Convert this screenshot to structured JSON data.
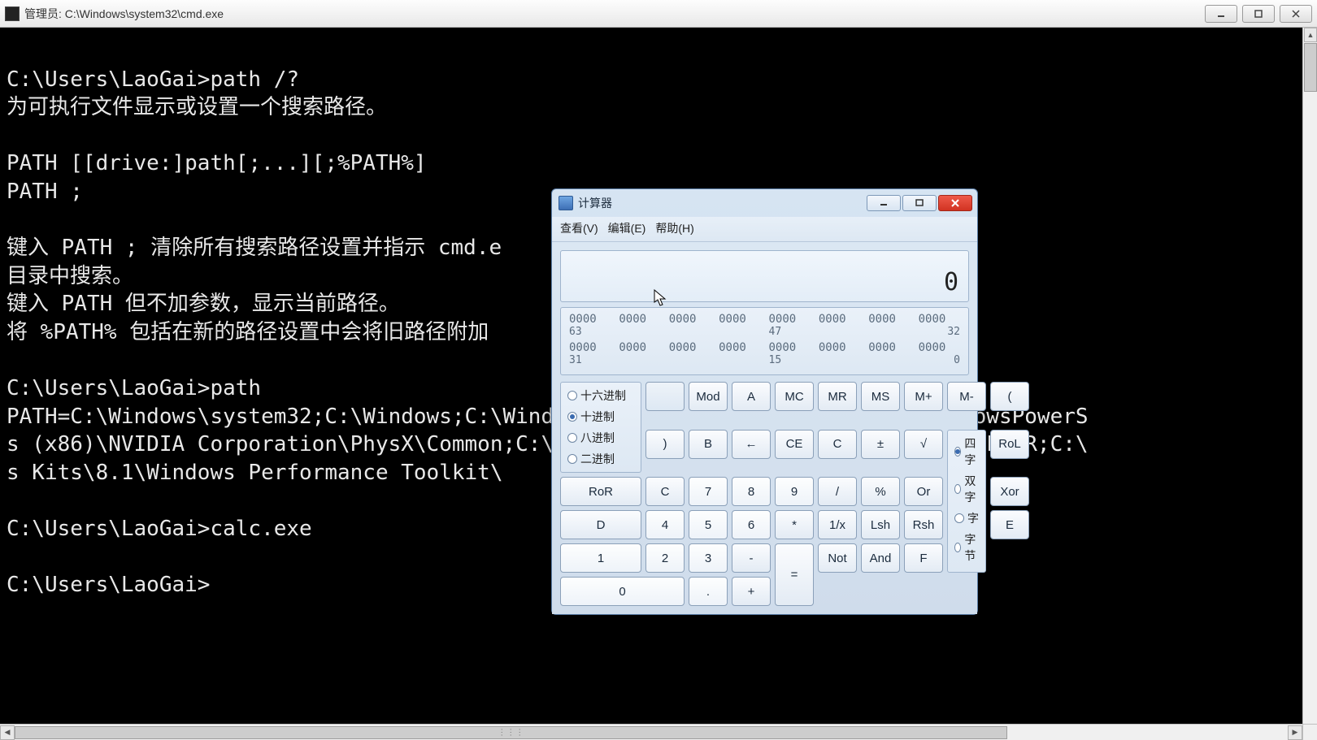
{
  "cmd": {
    "title": "管理员: C:\\Windows\\system32\\cmd.exe",
    "lines": [
      "",
      "C:\\Users\\LaoGai>path /?",
      "为可执行文件显示或设置一个搜索路径。",
      "",
      "PATH [[drive:]path[;...][;%PATH%]",
      "PATH ;",
      "",
      "键入 PATH ; 清除所有搜索路径设置并指示 cmd.e",
      "目录中搜索。",
      "键入 PATH 但不加参数，显示当前路径。",
      "将 %PATH% 包括在新的路径设置中会将旧路径附加",
      "",
      "C:\\Users\\LaoGai>path",
      "PATH=C:\\Windows\\system32;C:\\Windows;C:\\Window                         2\\WindowsPowerS",
      "s (x86)\\NVIDIA Corporation\\PhysX\\Common;C:\\P                          DIA NvDLISR;C:\\",
      "s Kits\\8.1\\Windows Performance Toolkit\\",
      "",
      "C:\\Users\\LaoGai>calc.exe",
      "",
      "C:\\Users\\LaoGai>"
    ]
  },
  "calc": {
    "title": "计算器",
    "menu": {
      "view": "查看(V)",
      "edit": "编辑(E)",
      "help": "帮助(H)"
    },
    "display": "0",
    "bits": {
      "row1": [
        "0000",
        "0000",
        "0000",
        "0000",
        "0000",
        "0000",
        "0000",
        "0000"
      ],
      "labels1": [
        "63",
        "",
        "",
        "",
        "47",
        "",
        "",
        "32"
      ],
      "row2": [
        "0000",
        "0000",
        "0000",
        "0000",
        "0000",
        "0000",
        "0000",
        "0000"
      ],
      "labels2": [
        "31",
        "",
        "",
        "",
        "15",
        "",
        "",
        "0"
      ]
    },
    "base": {
      "hex": "十六进制",
      "dec": "十进制",
      "oct": "八进制",
      "bin": "二进制",
      "selected": "dec"
    },
    "word": {
      "qword": "四字",
      "dword": "双字",
      "word": "字",
      "byte": "字节",
      "selected": "qword"
    },
    "buttons": {
      "mod": "Mod",
      "a": "A",
      "mc": "MC",
      "mr": "MR",
      "ms": "MS",
      "mplus": "M+",
      "mminus": "M-",
      "lp": "(",
      "rp": ")",
      "b": "B",
      "back": "←",
      "ce": "CE",
      "c": "C",
      "pm": "±",
      "sqrt": "√",
      "rol": "RoL",
      "ror": "RoR",
      "cc": "C",
      "n7": "7",
      "n8": "8",
      "n9": "9",
      "div": "/",
      "pct": "%",
      "or": "Or",
      "xor": "Xor",
      "d": "D",
      "n4": "4",
      "n5": "5",
      "n6": "6",
      "mul": "*",
      "inv": "1/x",
      "lsh": "Lsh",
      "rsh": "Rsh",
      "e": "E",
      "n1": "1",
      "n2": "2",
      "n3": "3",
      "sub": "-",
      "eq": "=",
      "not": "Not",
      "and": "And",
      "f": "F",
      "n0": "0",
      "dot": ".",
      "add": "+"
    }
  }
}
